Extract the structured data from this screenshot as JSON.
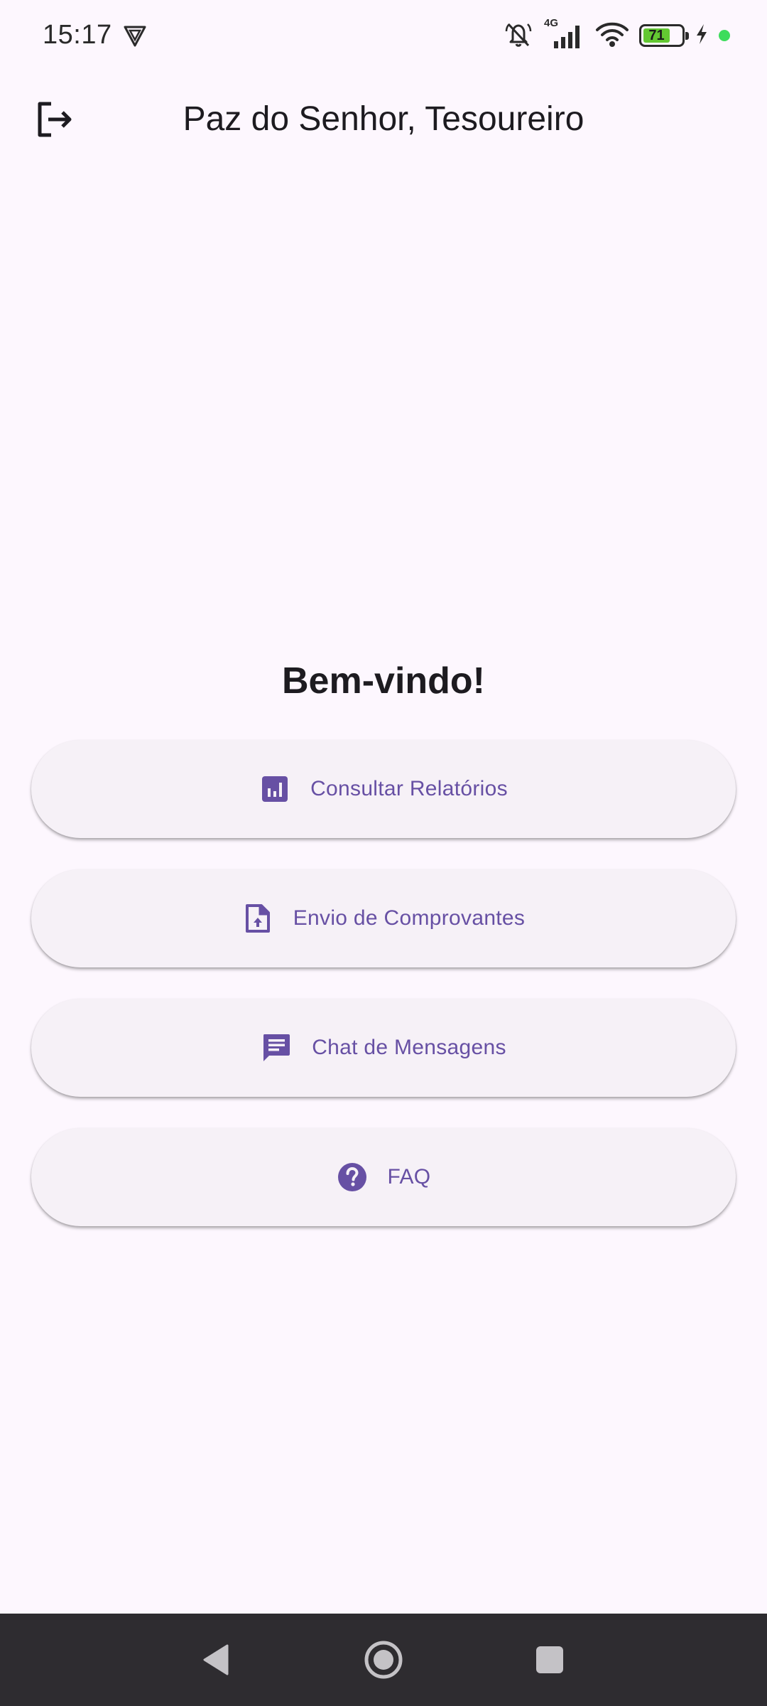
{
  "status_bar": {
    "time": "15:17",
    "network_label": "4G",
    "battery_level": "71",
    "battery_fraction": 0.71,
    "colors": {
      "battery_fill": "#63C832",
      "dot": "#3DDC5C"
    },
    "icons": [
      "vpn-shield-icon",
      "mute-bell-icon",
      "signal-icon",
      "wifi-icon",
      "battery-icon",
      "charging-bolt-icon"
    ]
  },
  "app_bar": {
    "title": "Paz do Senhor, Tesoureiro",
    "leading_icon": "logout-icon"
  },
  "main": {
    "welcome": "Bem-vindo!",
    "buttons": [
      {
        "label": "Consultar Relatórios",
        "icon": "bar-chart-icon"
      },
      {
        "label": "Envio de Comprovantes",
        "icon": "file-upload-icon"
      },
      {
        "label": "Chat de Mensagens",
        "icon": "chat-icon"
      },
      {
        "label": "FAQ",
        "icon": "help-icon"
      }
    ]
  },
  "nav_bar": {
    "icons": [
      "back-icon",
      "home-icon",
      "recents-icon"
    ]
  },
  "colors": {
    "background": "#FDF7FE",
    "accent": "#6750A4",
    "button_bg": "#F6F1F7",
    "nav_bg": "#2E2C30"
  }
}
